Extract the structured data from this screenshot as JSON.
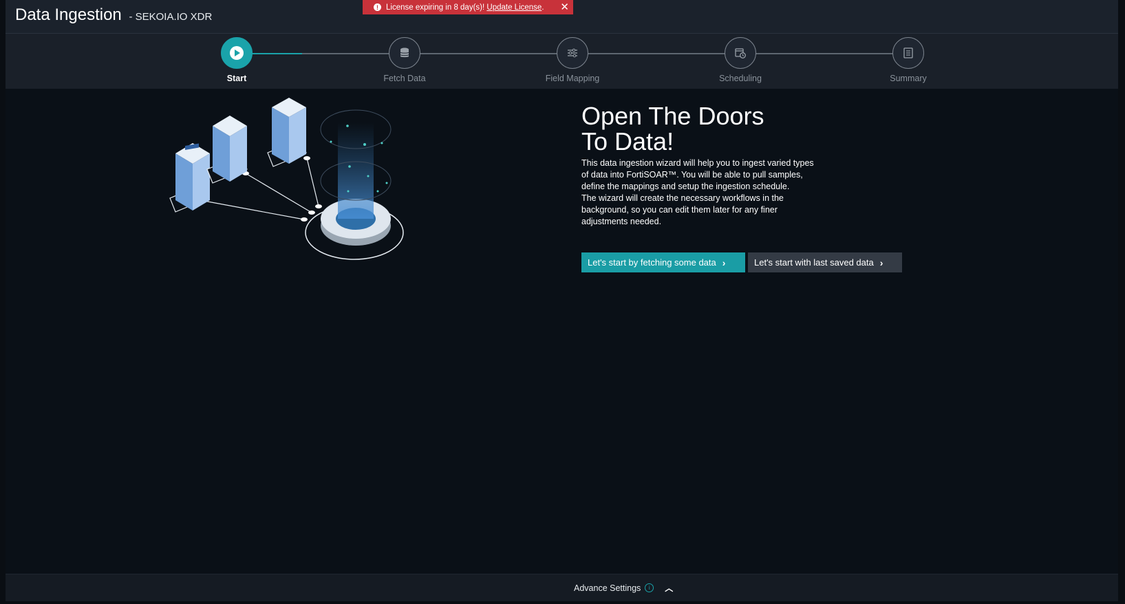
{
  "header": {
    "title": "Data Ingestion",
    "subtitle": "- SEKOIA.IO XDR"
  },
  "license_banner": {
    "message": "License expiring in 8 day(s)!",
    "link_text": "Update License",
    "suffix": ".",
    "close": "✕"
  },
  "stepper": {
    "progress": 0.4,
    "steps": [
      {
        "label": "Start",
        "icon": "play-icon",
        "active": true
      },
      {
        "label": "Fetch Data",
        "icon": "database-icon",
        "active": false
      },
      {
        "label": "Field Mapping",
        "icon": "sliders-icon",
        "active": false
      },
      {
        "label": "Scheduling",
        "icon": "calendar-clock-icon",
        "active": false
      },
      {
        "label": "Summary",
        "icon": "document-icon",
        "active": false
      }
    ]
  },
  "hero": {
    "title_line1": "Open The Doors",
    "title_line2": "To Data!",
    "desc1": "This data ingestion wizard will help you to ingest varied types of data into FortiSOAR™. You will be able to pull samples, define the mappings and setup the ingestion schedule.",
    "desc2": "The wizard will create the necessary workflows in the background, so you can edit them later for any finer adjustments needed.",
    "primary_button": "Let's start by fetching some data",
    "secondary_button": "Let's start with last saved data"
  },
  "footer": {
    "advance_settings": "Advance Settings"
  },
  "colors": {
    "accent": "#1aa3aa",
    "danger": "#c8323a",
    "background": "#0a1017",
    "header": "#1b222c"
  }
}
